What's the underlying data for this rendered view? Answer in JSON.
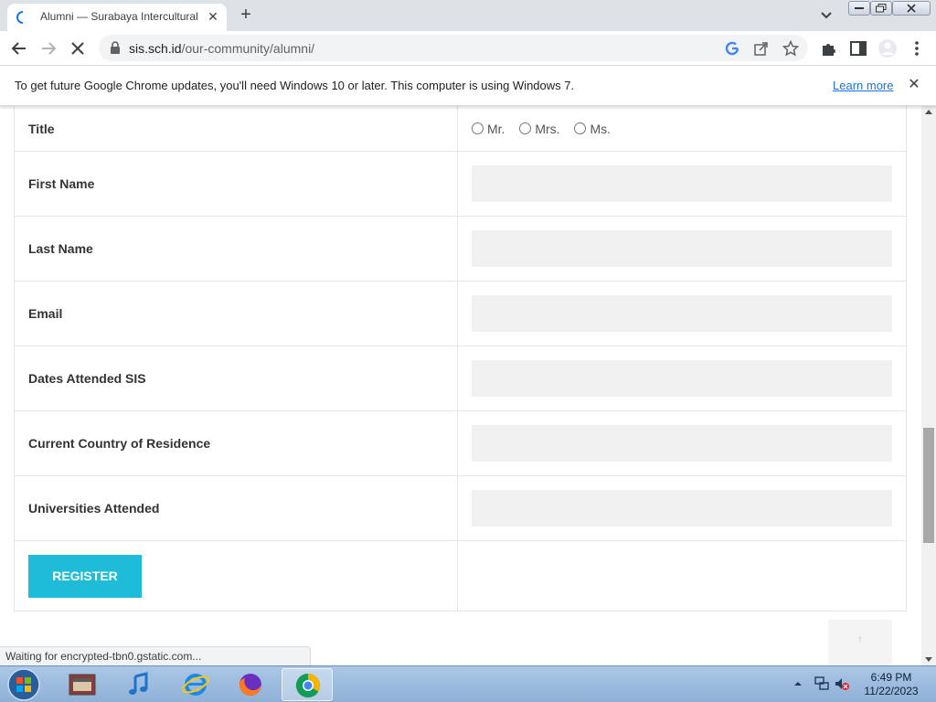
{
  "browser": {
    "tab_title": "Alumni — Surabaya Intercultural",
    "tab_close": "✕",
    "new_tab": "+",
    "url_host": "sis.sch.id",
    "url_path": "/our-community/alumni/"
  },
  "infobar": {
    "message": "To get future Google Chrome updates, you'll need Windows 10 or later. This computer is using Windows 7.",
    "link": "Learn more",
    "close": "✕"
  },
  "form": {
    "title_label": "Title",
    "title_options": [
      "Mr.",
      "Mrs.",
      "Ms."
    ],
    "rows": [
      {
        "label": "First Name",
        "value": ""
      },
      {
        "label": "Last Name",
        "value": ""
      },
      {
        "label": "Email",
        "value": ""
      },
      {
        "label": "Dates Attended SIS",
        "value": ""
      },
      {
        "label": "Current Country of Residence",
        "value": ""
      },
      {
        "label": "Universities Attended",
        "value": ""
      }
    ],
    "register_label": "REGISTER"
  },
  "back_to_top": "↑",
  "status_text": "Waiting for encrypted-tbn0.gstatic.com...",
  "taskbar": {
    "time": "6:49 PM",
    "date": "11/22/2023",
    "apps": [
      "media-center-icon",
      "itunes-icon",
      "internet-explorer-icon",
      "firefox-icon",
      "chrome-icon"
    ]
  },
  "colors": {
    "register_button": "#1ebcd8",
    "input_bg": "#f0f0f0",
    "link": "#1a73e8"
  }
}
